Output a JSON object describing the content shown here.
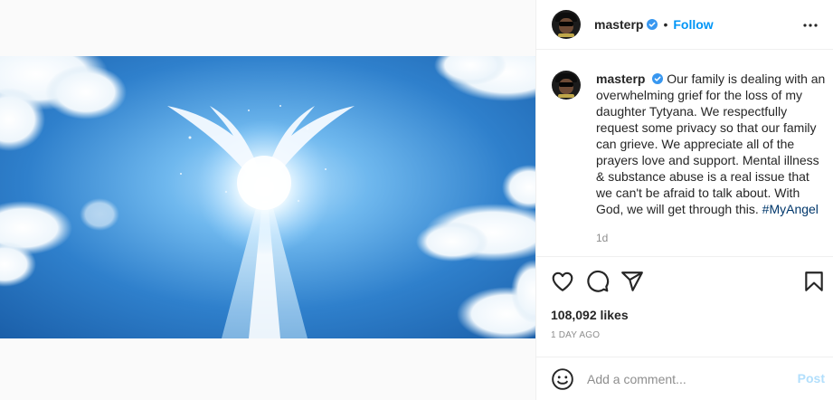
{
  "header": {
    "username": "masterp",
    "separator": "•",
    "follow_label": "Follow"
  },
  "caption": {
    "username": "masterp",
    "text": "Our family is dealing with an overwhelming grief for the loss of my daughter Tytyana. We respectfully request some privacy so that our family can grieve. We appreciate all of the prayers love and support. Mental illness & substance abuse is a real issue that we can't be afraid to talk about. With God, we will get through this.",
    "hashtag": "#MyAngel",
    "time_ago": "1d"
  },
  "post": {
    "likes": "108,092 likes",
    "date": "1 DAY AGO"
  },
  "comment": {
    "placeholder": "Add a comment...",
    "post_label": "Post"
  },
  "colors": {
    "link_blue": "#0095f6",
    "post_disabled": "#b2dffc",
    "hashtag": "#00376b",
    "muted": "#8e8e8e",
    "verified": "#3897f0"
  },
  "icons": [
    "more-icon",
    "heart-icon",
    "comment-icon",
    "share-icon",
    "bookmark-icon",
    "emoji-icon",
    "verified-icon"
  ]
}
